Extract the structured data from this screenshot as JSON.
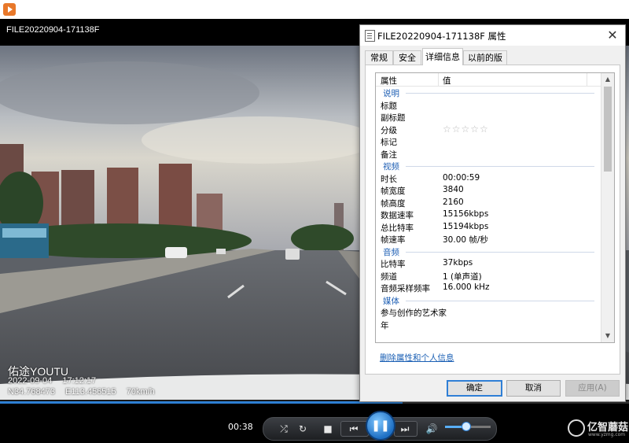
{
  "player": {
    "filename": "FILE20220904-171138F",
    "current_time": "00:38",
    "progress": 0.64,
    "volume": 0.45,
    "controls": {
      "shuffle_icon": "shuffle-icon",
      "repeat_icon": "repeat-icon",
      "stop_icon": "stop-icon",
      "previous_icon": "previous-icon",
      "play_pause_icon": "pause-icon",
      "next_icon": "next-icon",
      "volume_icon": "speaker-icon"
    }
  },
  "video_overlay": {
    "brand": "佑途YOUTU",
    "date": "2022-09-04",
    "time": "17:12:17",
    "lat": "N34.768473",
    "lon": "E113.456515",
    "speed": "70km/h"
  },
  "watermark": {
    "text": "亿智蘑菇",
    "url": "www.yzmg.com"
  },
  "dialog": {
    "title": "FILE20220904-171138F 属性",
    "close_label": "✕",
    "tabs": [
      "常规",
      "安全",
      "详细信息",
      "以前的版本"
    ],
    "active_tab": "详细信息",
    "header": {
      "property": "属性",
      "value": "值"
    },
    "sections": [
      {
        "title": "说明",
        "rows": [
          {
            "key": "标题",
            "value": ""
          },
          {
            "key": "副标题",
            "value": ""
          },
          {
            "key": "分级",
            "value": "",
            "rating": 0,
            "rating_max": 5
          },
          {
            "key": "标记",
            "value": ""
          },
          {
            "key": "备注",
            "value": ""
          }
        ]
      },
      {
        "title": "视频",
        "rows": [
          {
            "key": "时长",
            "value": "00:00:59"
          },
          {
            "key": "帧宽度",
            "value": "3840"
          },
          {
            "key": "帧高度",
            "value": "2160"
          },
          {
            "key": "数据速率",
            "value": "15156kbps"
          },
          {
            "key": "总比特率",
            "value": "15194kbps"
          },
          {
            "key": "帧速率",
            "value": "30.00 帧/秒"
          }
        ]
      },
      {
        "title": "音频",
        "rows": [
          {
            "key": "比特率",
            "value": "37kbps"
          },
          {
            "key": "频道",
            "value": "1 (单声道)"
          },
          {
            "key": "音频采样频率",
            "value": "16.000 kHz"
          }
        ]
      },
      {
        "title": "媒体",
        "rows": [
          {
            "key": "参与创作的艺术家",
            "value": ""
          },
          {
            "key": "年",
            "value": ""
          }
        ]
      }
    ],
    "remove_link": "删除属性和个人信息",
    "buttons": {
      "ok": "确定",
      "cancel": "取消",
      "apply": "应用(A)"
    }
  },
  "colors": {
    "accent": "#2f7fd6",
    "section_title": "#1e5fb4",
    "link": "#1a5fb4"
  }
}
